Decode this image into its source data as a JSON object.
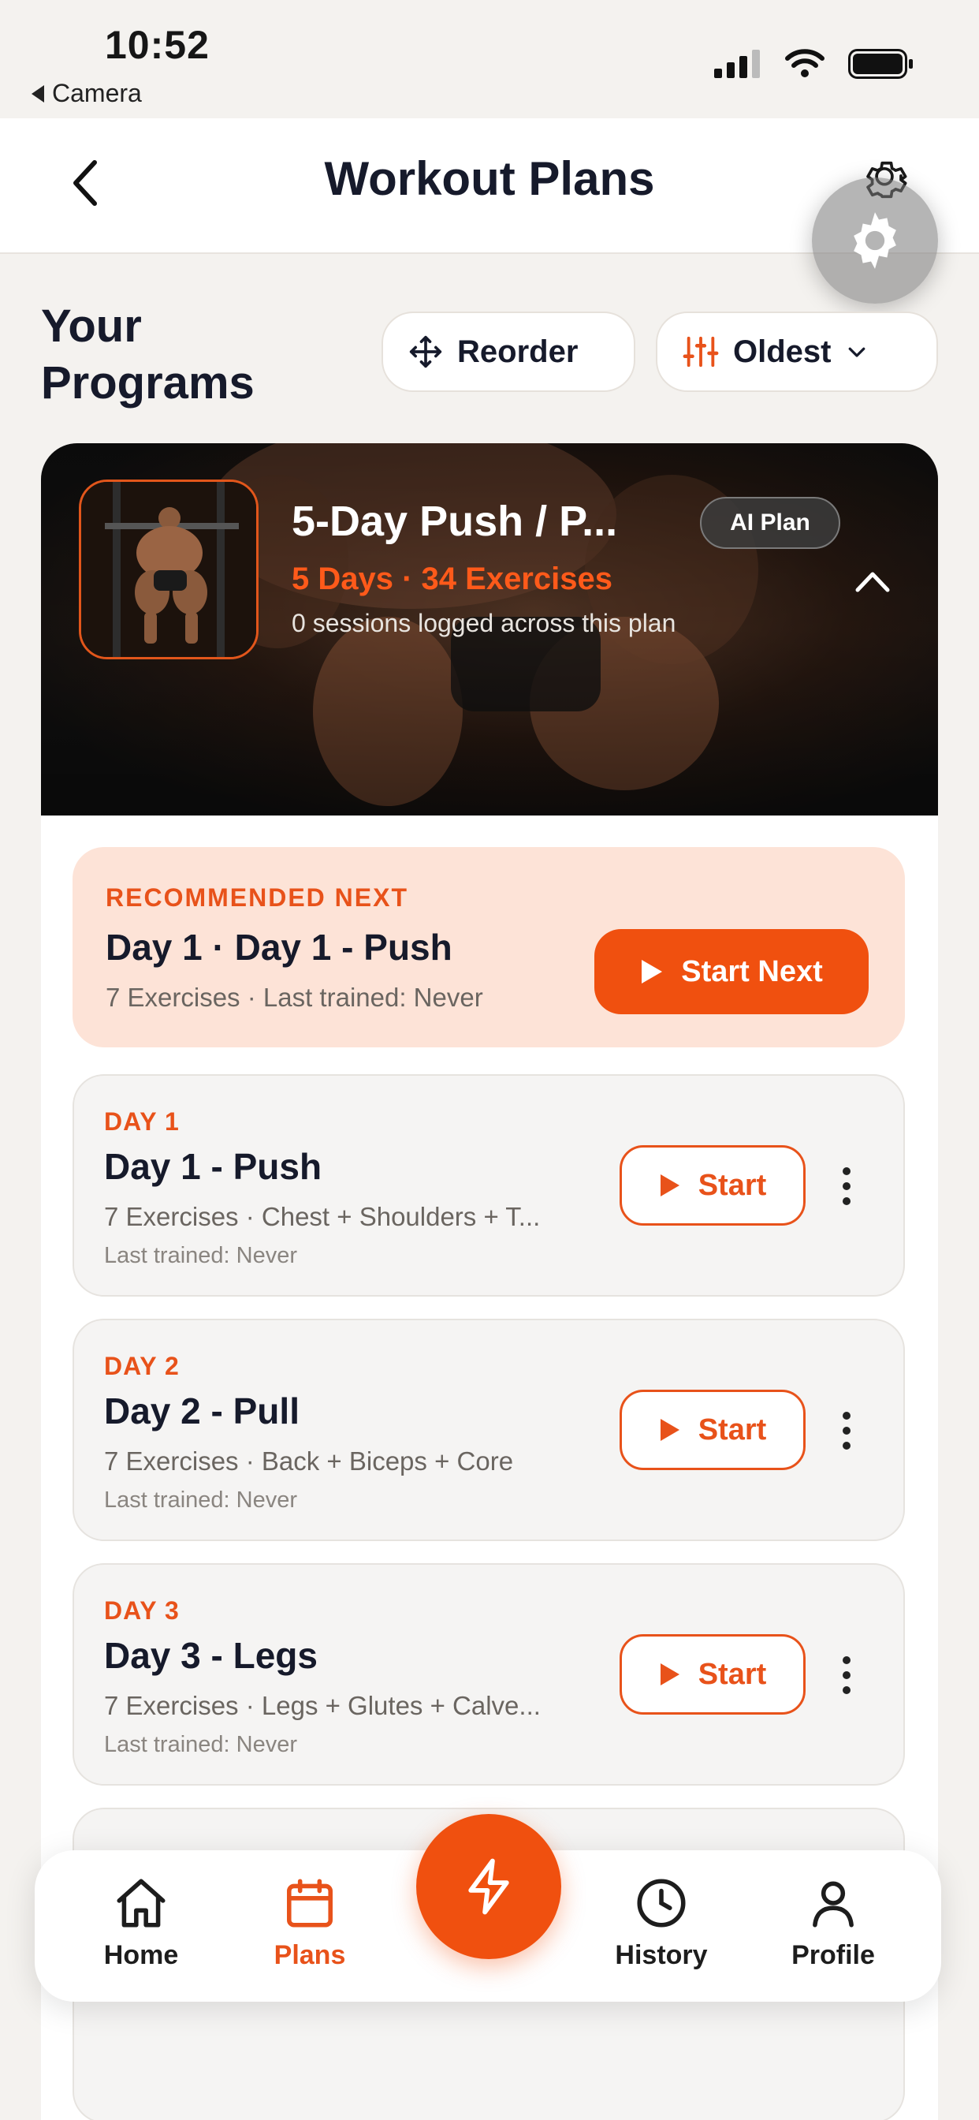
{
  "status_bar": {
    "time": "10:52",
    "back_app": "Camera"
  },
  "header": {
    "title": "Workout Plans"
  },
  "programs": {
    "title_line1": "Your",
    "title_line2": "Programs",
    "reorder_label": "Reorder",
    "sort_label": "Oldest"
  },
  "plan": {
    "name": "5-Day Push / P...",
    "badge": "AI Plan",
    "meta": "5 Days · 34 Exercises",
    "sessions": "0 sessions logged across this plan"
  },
  "recommended": {
    "label": "RECOMMENDED NEXT",
    "title": "Day 1 · Day 1 - Push",
    "subtitle": "7 Exercises · Last trained: Never",
    "button": "Start Next"
  },
  "days": [
    {
      "label": "DAY 1",
      "title": "Day 1 - Push",
      "subtitle": "7 Exercises · Chest + Shoulders + T...",
      "last": "Last trained: Never",
      "button": "Start"
    },
    {
      "label": "DAY 2",
      "title": "Day 2 - Pull",
      "subtitle": "7 Exercises · Back + Biceps + Core",
      "last": "Last trained: Never",
      "button": "Start"
    },
    {
      "label": "DAY 3",
      "title": "Day 3 - Legs",
      "subtitle": "7 Exercises · Legs + Glutes + Calve...",
      "last": "Last trained: Never",
      "button": "Start"
    }
  ],
  "tabs": [
    {
      "label": "Home",
      "icon": "home-icon"
    },
    {
      "label": "Plans",
      "icon": "calendar-icon",
      "active": true
    },
    {
      "label": "History",
      "icon": "clock-icon"
    },
    {
      "label": "Profile",
      "icon": "user-icon"
    }
  ],
  "colors": {
    "accent": "#f0500f",
    "accent_soft": "#fde3d7",
    "text": "#161a2b"
  }
}
